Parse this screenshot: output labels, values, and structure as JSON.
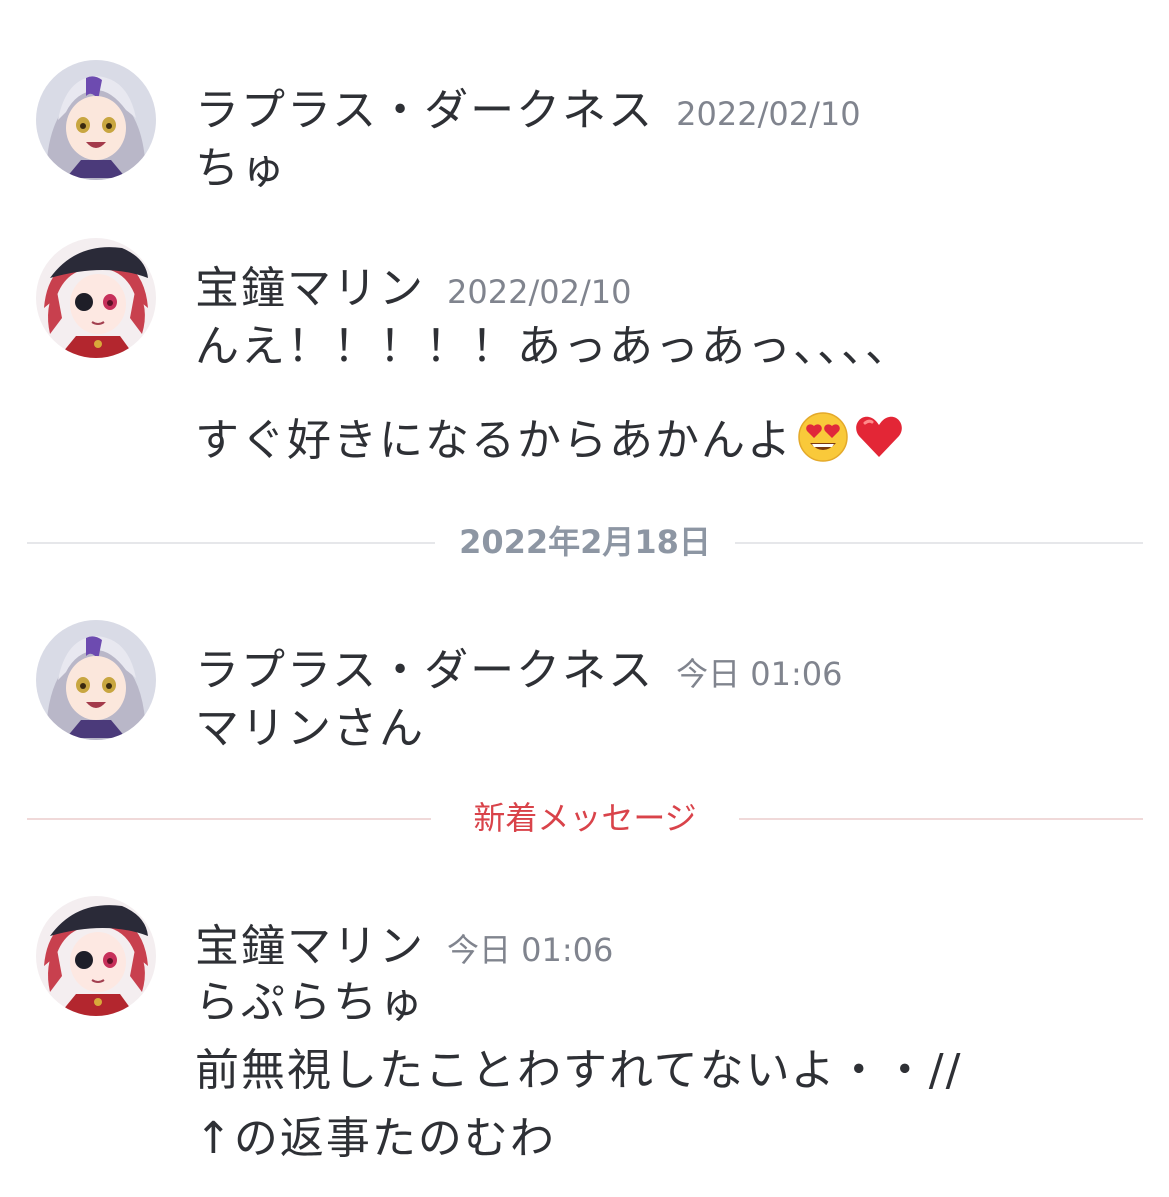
{
  "messages": [
    {
      "author": "ラプラス・ダークネス",
      "time": "2022/02/10",
      "avatar": "laplus-avatar",
      "lines": [
        "ちゅ"
      ]
    },
    {
      "author": "宝鐘マリン",
      "time": "2022/02/10",
      "avatar": "marine-avatar",
      "lines": [
        "んえ！！！！！あっあっあっ、、、、",
        "すぐ好きになるからあかんよ"
      ],
      "emoji": [
        "heart-eyes-emoji",
        "red-heart-emoji"
      ]
    },
    {
      "author": "ラプラス・ダークネス",
      "time": "今日 01:06",
      "avatar": "laplus-avatar",
      "lines": [
        "マリンさん"
      ]
    },
    {
      "author": "宝鐘マリン",
      "time": "今日 01:06",
      "avatar": "marine-avatar",
      "lines": [
        "らぷらちゅ",
        "前無視したことわすれてないよ・・//",
        "↑の返事たのむわ"
      ]
    }
  ],
  "dividers": {
    "date": "2022年2月18日",
    "new_messages": "新着メッセージ"
  },
  "colors": {
    "text": "#2e3035",
    "timestamp": "#80848e",
    "date_divider": "#8d96a3",
    "new_divider": "#d9434a"
  }
}
